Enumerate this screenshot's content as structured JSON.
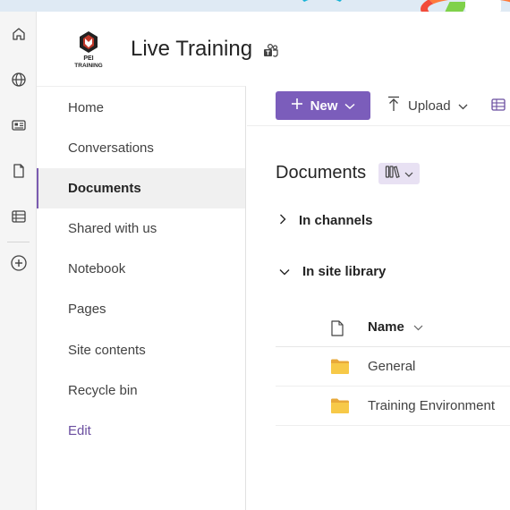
{
  "rail": {
    "icons": [
      "home-icon",
      "globe-icon",
      "news-icon",
      "file-icon",
      "list-icon",
      "add-icon"
    ]
  },
  "site": {
    "logo_text": "PEI TRAINING",
    "title": "Live Training",
    "teams_icon": "teams-icon"
  },
  "nav": {
    "items": [
      {
        "label": "Home",
        "active": false
      },
      {
        "label": "Conversations",
        "active": false
      },
      {
        "label": "Documents",
        "active": true
      },
      {
        "label": "Shared with us",
        "active": false
      },
      {
        "label": "Notebook",
        "active": false
      },
      {
        "label": "Pages",
        "active": false
      },
      {
        "label": "Site contents",
        "active": false
      },
      {
        "label": "Recycle bin",
        "active": false
      }
    ],
    "edit_label": "Edit"
  },
  "toolbar": {
    "new_label": "New",
    "upload_label": "Upload"
  },
  "main": {
    "title": "Documents",
    "groups": [
      {
        "label": "In channels",
        "expanded": false
      },
      {
        "label": "In site library",
        "expanded": true
      }
    ],
    "columns": {
      "name": "Name"
    },
    "rows": [
      {
        "name": "General",
        "icon": "folder-icon"
      },
      {
        "name": "Training Environment",
        "icon": "folder-icon"
      }
    ]
  },
  "colors": {
    "accent": "#7b5dbb",
    "active_bar": "#7a5bb0",
    "folder": "#f7c948",
    "edit_link": "#6b4fa0"
  }
}
